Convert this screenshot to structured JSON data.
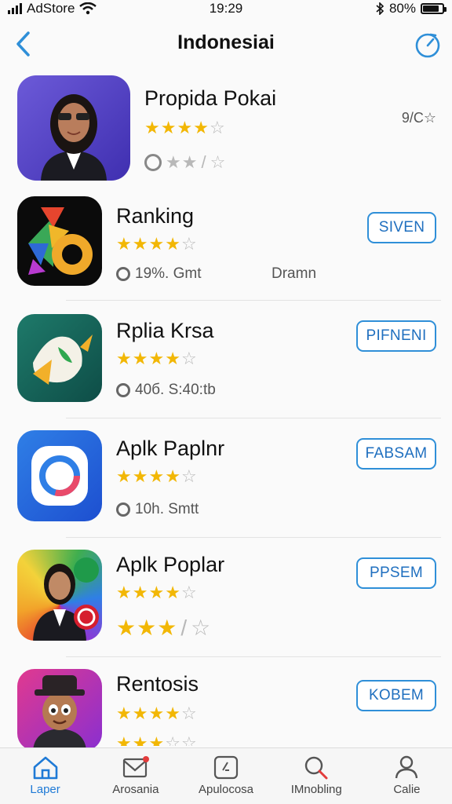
{
  "status_bar": {
    "carrier": "AdStore",
    "time": "19:29",
    "battery": "80%"
  },
  "nav": {
    "title": "Indonesiai"
  },
  "apps": [
    {
      "name": "Propida Pokai",
      "rating": 4,
      "meta_left": "",
      "meta_right": "",
      "side_text": "9/C☆",
      "button": ""
    },
    {
      "name": "Ranking",
      "rating": 4,
      "meta_left": "19%. Gmt",
      "meta_right": "Dramn",
      "side_text": "",
      "button": "SIVEN"
    },
    {
      "name": "Rplia Krsa",
      "rating": 4,
      "meta_left": "40б. S:40:tb",
      "meta_right": "",
      "side_text": "",
      "button": "PIFNENI"
    },
    {
      "name": "Aplk Paplnr",
      "rating": 4,
      "meta_left": "10h. Smtt",
      "meta_right": "",
      "side_text": "",
      "button": "FABSAM"
    },
    {
      "name": "Aplk Poplar",
      "rating": 4,
      "meta_left": "",
      "meta_right": "",
      "side_text": "",
      "button": "PPSEM"
    },
    {
      "name": "Rentosis",
      "rating": 4,
      "meta_left": "",
      "meta_right": "",
      "side_text": "",
      "button": "KOBEM"
    }
  ],
  "tabs": [
    {
      "label": "Laper",
      "icon": "home-icon",
      "active": true
    },
    {
      "label": "Arosania",
      "icon": "mail-icon",
      "active": false
    },
    {
      "label": "Apulocosa",
      "icon": "app-box-icon",
      "active": false
    },
    {
      "label": "IMnobling",
      "icon": "search-icon",
      "active": false
    },
    {
      "label": "Calie",
      "icon": "person-icon",
      "active": false
    }
  ],
  "colors": {
    "accent": "#2f8fd8",
    "star": "#f2b705"
  }
}
